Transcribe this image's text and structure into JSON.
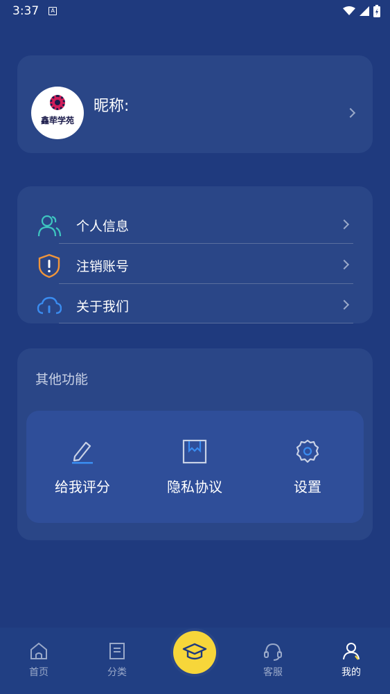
{
  "status_bar": {
    "time": "3:37",
    "notification_icon": "A"
  },
  "profile": {
    "nickname_label": "昵称:",
    "avatar_text": "鑫荦学苑"
  },
  "menu": {
    "items": [
      {
        "label": "个人信息",
        "icon": "users-icon"
      },
      {
        "label": "注销账号",
        "icon": "shield-alert-icon"
      },
      {
        "label": "关于我们",
        "icon": "cloud-info-icon"
      }
    ]
  },
  "other": {
    "title": "其他功能",
    "items": [
      {
        "label": "给我评分",
        "icon": "pencil-icon"
      },
      {
        "label": "隐私协议",
        "icon": "bookmark-doc-icon"
      },
      {
        "label": "设置",
        "icon": "gear-icon"
      }
    ]
  },
  "tabbar": {
    "tabs": [
      {
        "label": "首页",
        "icon": "home-icon"
      },
      {
        "label": "分类",
        "icon": "book-icon"
      },
      {
        "label": "",
        "icon": "graduation-cap-icon"
      },
      {
        "label": "客服",
        "icon": "headset-icon"
      },
      {
        "label": "我的",
        "icon": "user-icon"
      }
    ],
    "active": "我的"
  },
  "colors": {
    "background": "#1f3a7e",
    "card": "#2a4687",
    "panel": "#2f4e99",
    "accent_yellow": "#f7d63a",
    "teal": "#3ec6c0",
    "orange": "#f0953a",
    "blue": "#3a8cf0"
  }
}
